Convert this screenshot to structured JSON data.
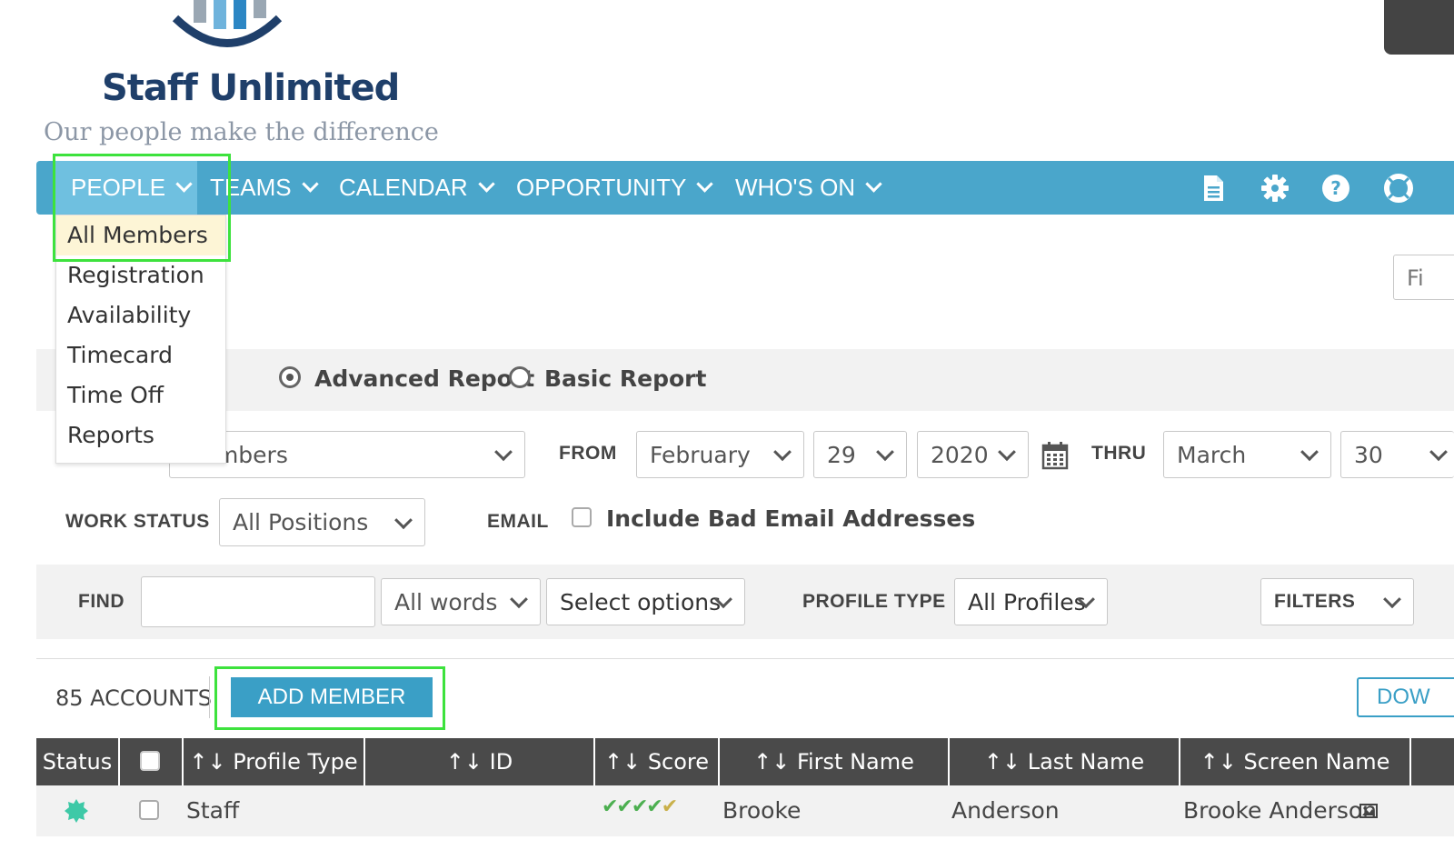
{
  "brand": {
    "name": "Staff Unlimited",
    "tagline": "Our people make the difference"
  },
  "nav": {
    "items": [
      {
        "label": "PEOPLE"
      },
      {
        "label": "TEAMS"
      },
      {
        "label": "CALENDAR"
      },
      {
        "label": "OPPORTUNITY"
      },
      {
        "label": "WHO'S ON"
      }
    ],
    "icons": [
      "document-icon",
      "gear-icon",
      "help-icon",
      "lifebuoy-icon"
    ]
  },
  "people_menu": {
    "items": [
      "All Members",
      "Registration",
      "Availability",
      "Timecard",
      "Time Off",
      "Reports"
    ],
    "highlighted": "All Members"
  },
  "search_box_partial": "Fi",
  "report": {
    "advanced_label": "Advanced Report",
    "basic_label": "Basic Report",
    "selected": "Advanced Report"
  },
  "filters_row1": {
    "members_select": "Members",
    "from_label": "FROM",
    "from_month": "February",
    "from_day": "29",
    "from_year": "2020",
    "thru_label": "THRU",
    "thru_month": "March",
    "thru_day": "30"
  },
  "filters_row2": {
    "work_status_label": "WORK STATUS",
    "work_status_value": "All Positions",
    "email_label": "EMAIL",
    "bad_email_label": "Include Bad Email Addresses"
  },
  "find": {
    "label": "FIND",
    "value": "",
    "match_mode": "All words",
    "options_placeholder": "Select options",
    "profile_type_label": "PROFILE TYPE",
    "profile_type_value": "All Profiles",
    "filters_label": "FILTERS"
  },
  "accounts": {
    "count_label": "85 ACCOUNTS",
    "add_member_label": "ADD MEMBER",
    "download_partial": "DOW"
  },
  "table": {
    "sort_glyph": "↑↓",
    "columns": [
      "Status",
      "",
      "Profile Type",
      "ID",
      "Score",
      "First Name",
      "Last Name",
      "Screen Name"
    ],
    "rows": [
      {
        "status": "active",
        "profile_type": "Staff",
        "id": "",
        "score_checks": "✔✔✔✔✔",
        "first_name": "Brooke",
        "last_name": "Anderson",
        "screen_name": "Brooke Anderson"
      }
    ]
  },
  "colors": {
    "nav_bg": "#4aa6cb",
    "nav_active": "#6fc0e0",
    "button_blue": "#3a9fc6",
    "header_dark": "#4a4a4a",
    "highlight_yellow": "#fdf5d6",
    "annotation_green": "#3de23d",
    "score_green": "#4caf50",
    "score_gold": "#c9b04a",
    "status_teal": "#3ec9a7"
  }
}
